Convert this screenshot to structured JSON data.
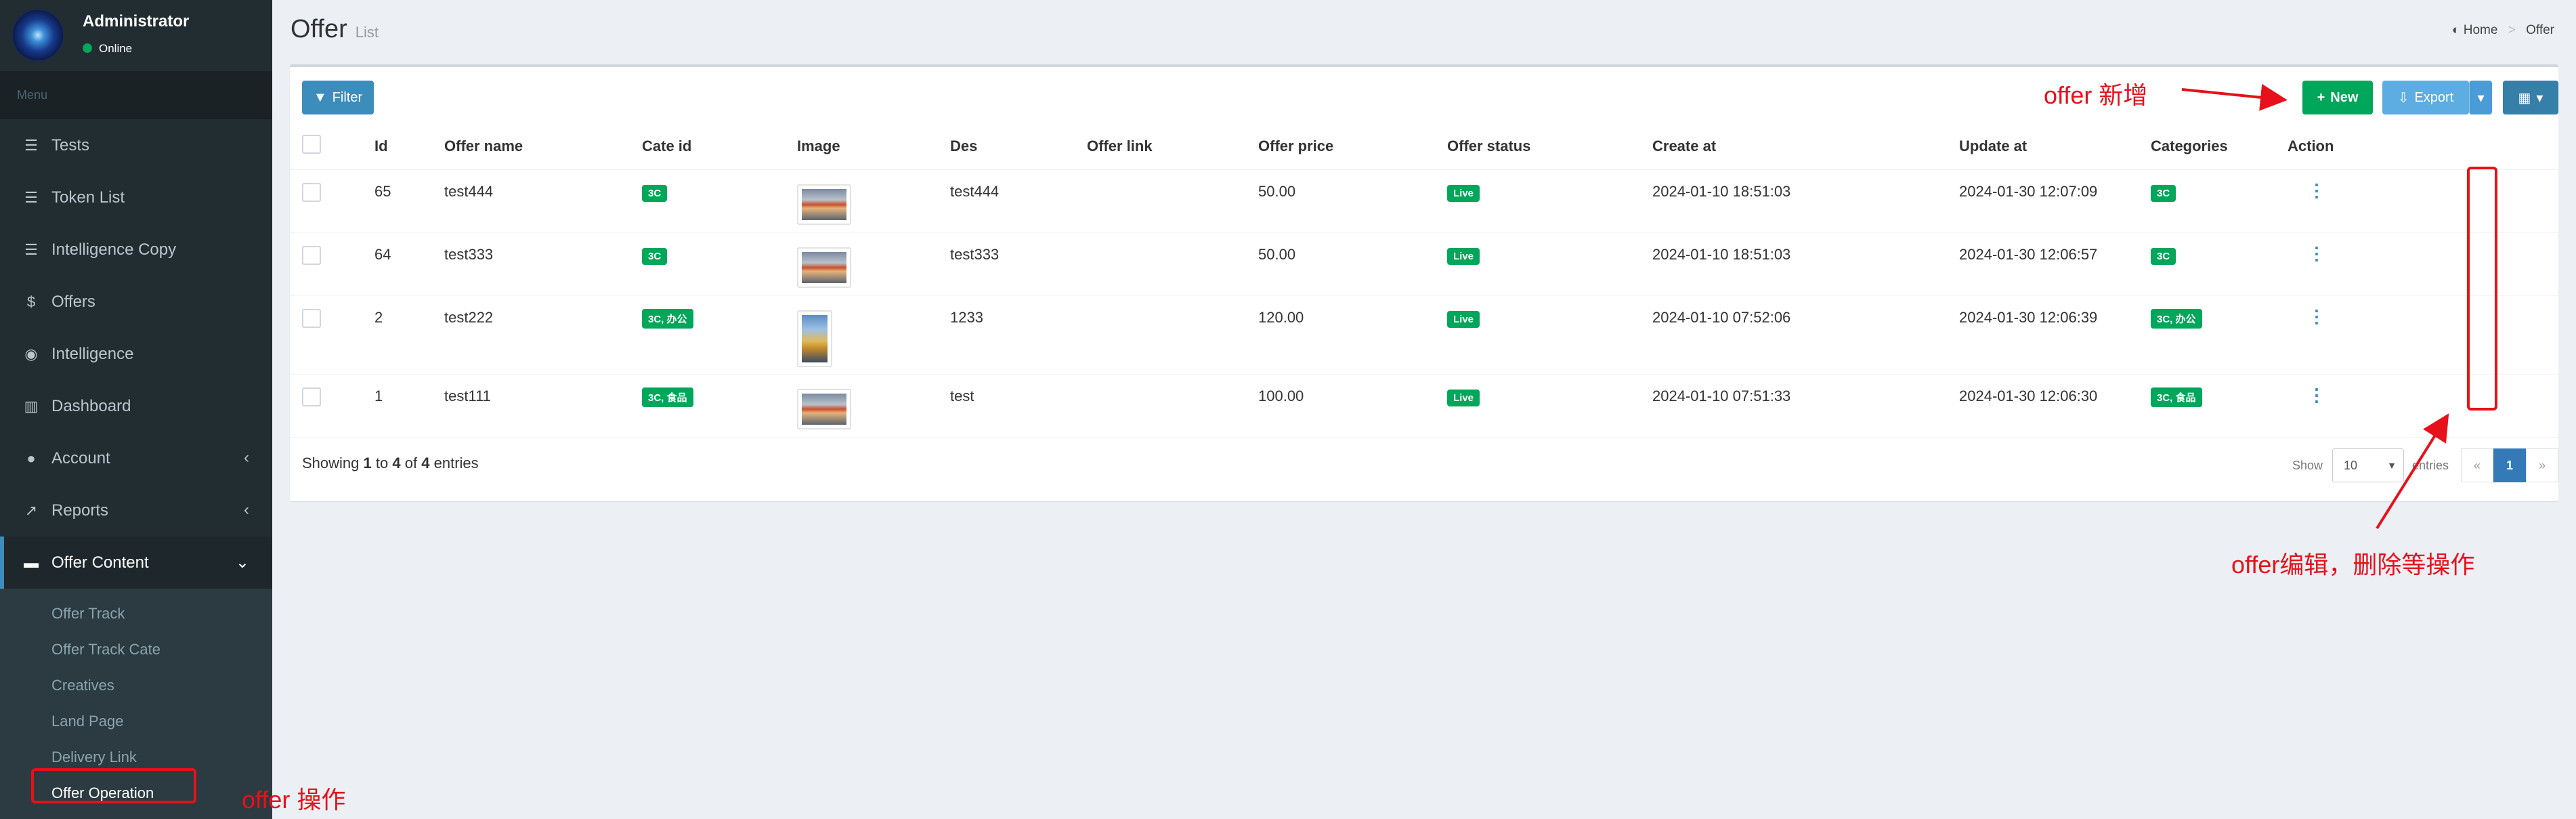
{
  "user": {
    "name": "Administrator",
    "status": "Online"
  },
  "menu_header": "Menu",
  "menu": [
    {
      "label": "Tests",
      "icon": "bars-icon"
    },
    {
      "label": "Token List",
      "icon": "bars-icon"
    },
    {
      "label": "Intelligence Copy",
      "icon": "bars-icon"
    },
    {
      "label": "Offers",
      "icon": "dollar-icon"
    },
    {
      "label": "Intelligence",
      "icon": "eye-icon"
    },
    {
      "label": "Dashboard",
      "icon": "bar-chart-icon"
    },
    {
      "label": "Account",
      "icon": "user-icon"
    },
    {
      "label": "Reports",
      "icon": "line-chart-icon"
    },
    {
      "label": "Offer Content",
      "icon": "folder-icon"
    }
  ],
  "submenu": [
    "Offer Track",
    "Offer Track Cate",
    "Creatives",
    "Land Page",
    "Delivery Link",
    "Offer Operation"
  ],
  "header": {
    "title": "Offer",
    "subtitle": "List"
  },
  "breadcrumb": {
    "home": "Home",
    "current": "Offer"
  },
  "toolbar": {
    "filter": "Filter",
    "new": "New",
    "export": "Export"
  },
  "table": {
    "columns": [
      "Id",
      "Offer name",
      "Cate id",
      "Image",
      "Des",
      "Offer link",
      "Offer price",
      "Offer status",
      "Create at",
      "Update at",
      "Categories",
      "Action"
    ],
    "rows": [
      {
        "id": "65",
        "name": "test444",
        "cate": "3C",
        "des": "test444",
        "link": "",
        "price": "50.00",
        "status": "Live",
        "created": "2024-01-10 18:51:03",
        "updated": "2024-01-30 12:07:09",
        "categories": "3C"
      },
      {
        "id": "64",
        "name": "test333",
        "cate": "3C",
        "des": "test333",
        "link": "",
        "price": "50.00",
        "status": "Live",
        "created": "2024-01-10 18:51:03",
        "updated": "2024-01-30 12:06:57",
        "categories": "3C"
      },
      {
        "id": "2",
        "name": "test222",
        "cate": "3C, 办公",
        "des": "1233",
        "link": "",
        "price": "120.00",
        "status": "Live",
        "created": "2024-01-10 07:52:06",
        "updated": "2024-01-30 12:06:39",
        "categories": "3C, 办公"
      },
      {
        "id": "1",
        "name": "test111",
        "cate": "3C, 食品",
        "des": "test",
        "link": "",
        "price": "100.00",
        "status": "Live",
        "created": "2024-01-10 07:51:33",
        "updated": "2024-01-30 12:06:30",
        "categories": "3C, 食品"
      }
    ]
  },
  "footer": {
    "showing": "Showing",
    "from": "1",
    "to_word": "to",
    "to": "4",
    "of_word": "of",
    "total": "4",
    "entries": "entries"
  },
  "pagination": {
    "show": "Show",
    "length": "10",
    "entries": "entries",
    "prev": "«",
    "page": "1",
    "next": "»"
  },
  "annotations": {
    "new_label": "offer 新增",
    "edit_label": "offer编辑，删除等操作",
    "operation_label": "offer 操作",
    "color": "#e8101a"
  },
  "colors": {
    "sidebar": "#222d32",
    "primary": "#3c8dbc",
    "success": "#00a65a"
  }
}
